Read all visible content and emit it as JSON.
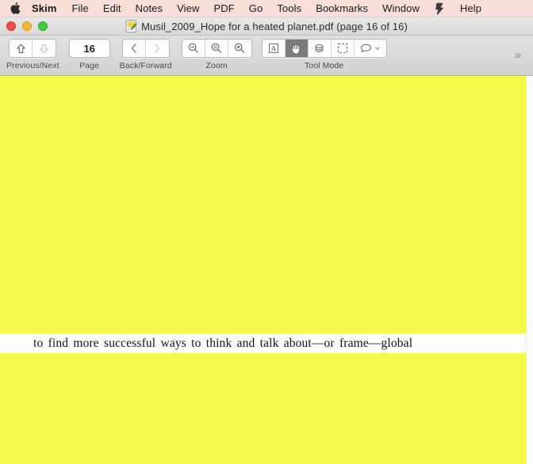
{
  "menubar": {
    "apple_icon": "apple-logo",
    "items": [
      {
        "label": "Skim",
        "bold": true
      },
      {
        "label": "File",
        "bold": false
      },
      {
        "label": "Edit",
        "bold": false
      },
      {
        "label": "Notes",
        "bold": false
      },
      {
        "label": "View",
        "bold": false
      },
      {
        "label": "PDF",
        "bold": false
      },
      {
        "label": "Go",
        "bold": false
      },
      {
        "label": "Tools",
        "bold": false
      },
      {
        "label": "Bookmarks",
        "bold": false
      },
      {
        "label": "Window",
        "bold": false
      }
    ],
    "extra_icon": "menu-extra-icon",
    "help": "Help",
    "background_color": "#f7dfd8"
  },
  "titlebar": {
    "title": "Musil_2009_Hope for a heated planet.pdf (page 16 of 16)",
    "doc_icon": "skim-pdf-document-icon",
    "close_label": "Close",
    "minimize_label": "Minimize",
    "maximize_label": "Zoom",
    "colors": {
      "close": "#ef4f46",
      "minimize": "#f7b731",
      "maximize": "#3fcb3c"
    }
  },
  "toolbar": {
    "groups": [
      {
        "name": "previous-next",
        "label": "Previous/Next",
        "buttons": [
          {
            "name": "previous-page-button",
            "icon": "arrow-up-icon",
            "enabled": true
          },
          {
            "name": "next-page-button",
            "icon": "arrow-down-icon",
            "enabled": false
          }
        ]
      },
      {
        "name": "page",
        "label": "Page",
        "value": "16"
      },
      {
        "name": "back-forward",
        "label": "Back/Forward",
        "buttons": [
          {
            "name": "back-button",
            "icon": "chevron-left-icon",
            "enabled": true
          },
          {
            "name": "forward-button",
            "icon": "chevron-right-icon",
            "enabled": false
          }
        ]
      },
      {
        "name": "zoom",
        "label": "Zoom",
        "buttons": [
          {
            "name": "zoom-out-button",
            "icon": "magnifier-minus-icon",
            "enabled": true
          },
          {
            "name": "zoom-actual-size-button",
            "icon": "magnifier-equals-icon",
            "enabled": true
          },
          {
            "name": "zoom-in-button",
            "icon": "magnifier-plus-icon",
            "enabled": true
          }
        ]
      },
      {
        "name": "tool-mode",
        "label": "Tool Mode",
        "buttons": [
          {
            "name": "text-tool-button",
            "icon": "letter-a-box-icon",
            "active": false
          },
          {
            "name": "scroll-hand-tool-button",
            "icon": "hand-icon",
            "active": true
          },
          {
            "name": "magnify-tool-button",
            "icon": "magnify-glass-tool-icon",
            "active": false
          },
          {
            "name": "select-tool-button",
            "icon": "dashed-selection-icon",
            "active": false
          },
          {
            "name": "note-tool-button",
            "icon": "note-bubble-icon",
            "active": false,
            "has_menu": true
          }
        ]
      }
    ],
    "overflow_label": "»"
  },
  "document": {
    "highlight_color": "#f4fa48",
    "page_text": "to find  more  successful  ways  to  think  and  talk  about—or  frame—global",
    "scrollbar": {
      "name": "vertical-scrollbar"
    }
  }
}
